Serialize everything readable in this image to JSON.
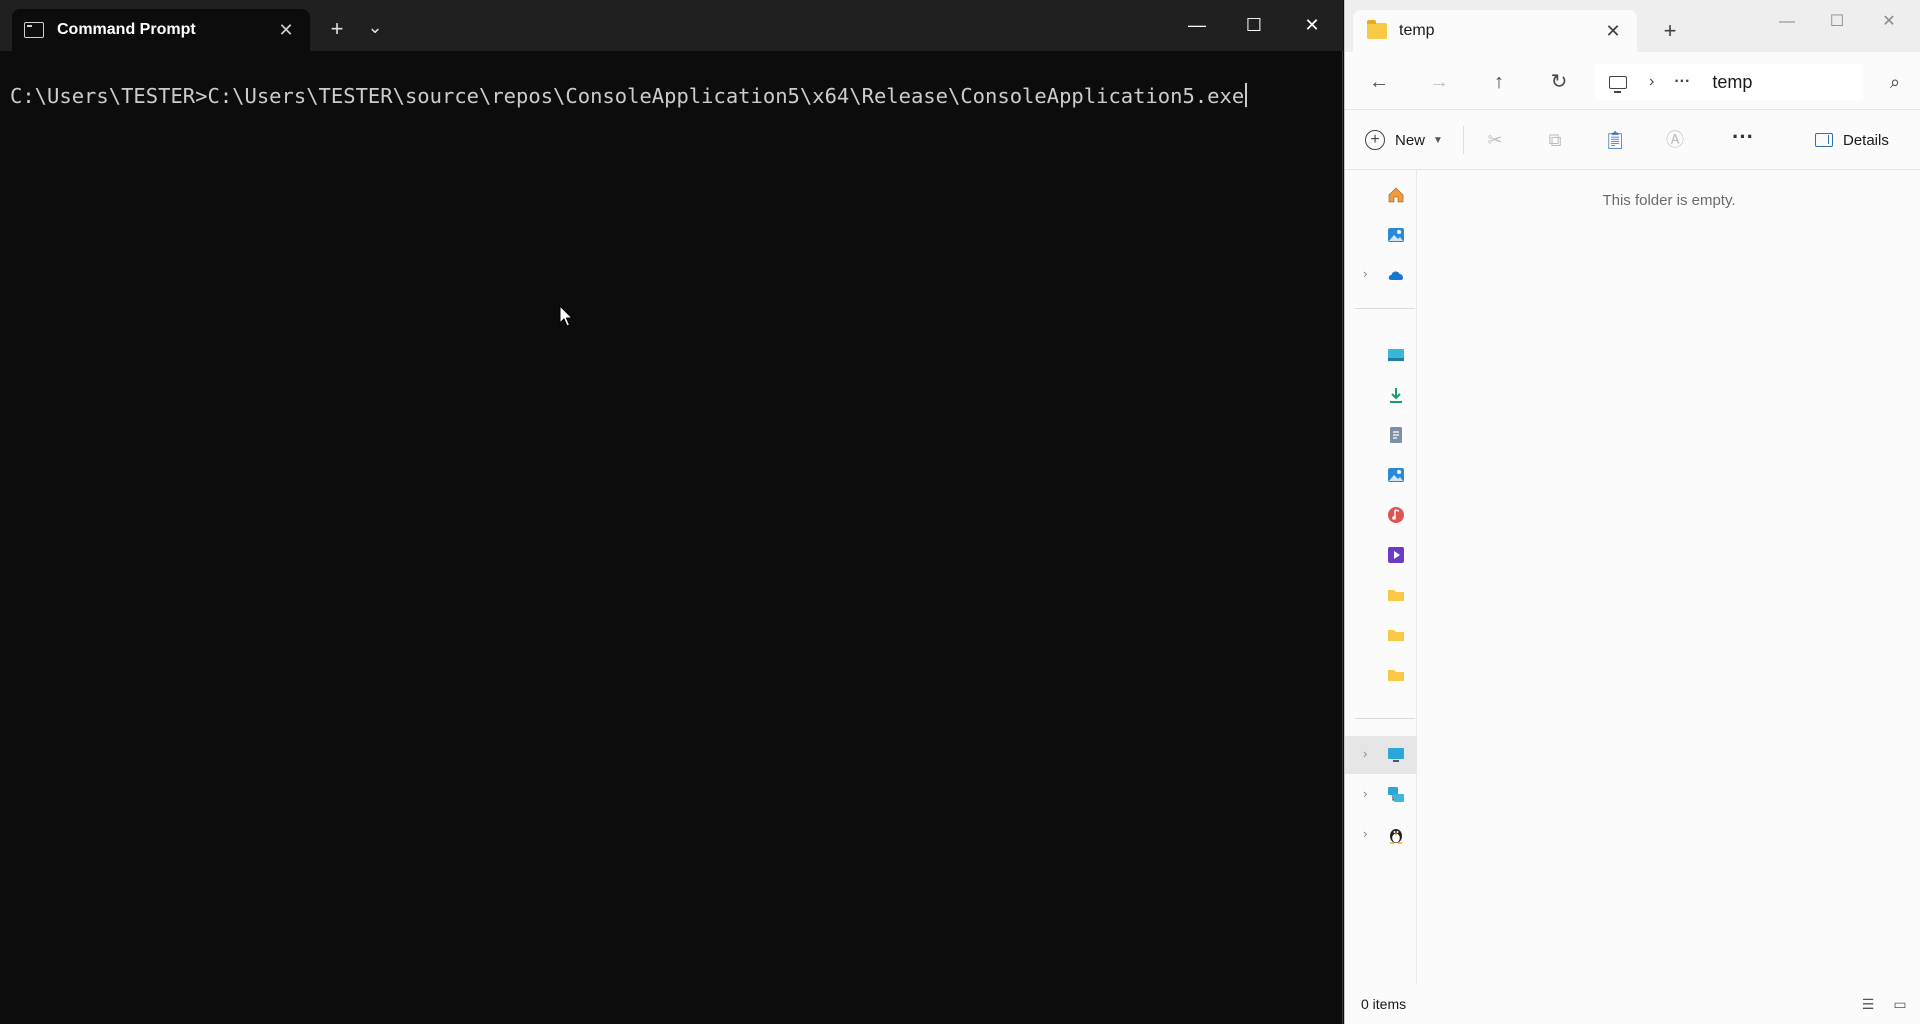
{
  "terminal": {
    "tab_title": "Command Prompt",
    "new_tab_symbol": "+",
    "dropdown_symbol": "⌄",
    "close_symbol": "✕",
    "minimize_symbol": "—",
    "maximize_symbol": "☐",
    "command_line": "C:\\Users\\TESTER>C:\\Users\\TESTER\\source\\repos\\ConsoleApplication5\\x64\\Release\\ConsoleApplication5.exe",
    "background": "#0c0c0c",
    "text_color": "#cccccc"
  },
  "explorer": {
    "tab_title": "temp",
    "close_symbol": "✕",
    "new_tab_symbol": "+",
    "address": {
      "root_icon": "computer-icon",
      "separator": "›",
      "overflow": "···",
      "current": "temp"
    },
    "toolbar": {
      "new_label": "New",
      "details_label": "Details",
      "more_symbol": "···"
    },
    "empty_message": "This folder is empty.",
    "status_count": "0 items",
    "sidebar_icons": [
      "home-icon",
      "gallery-icon",
      "onedrive-icon",
      "desktop-icon",
      "downloads-icon",
      "documents-icon",
      "pictures-icon",
      "music-icon",
      "videos-icon",
      "folder-icon",
      "folder-icon",
      "folder-icon",
      "this-pc-icon",
      "network-icon",
      "linux-icon"
    ],
    "accent": "#2d6fb7"
  }
}
